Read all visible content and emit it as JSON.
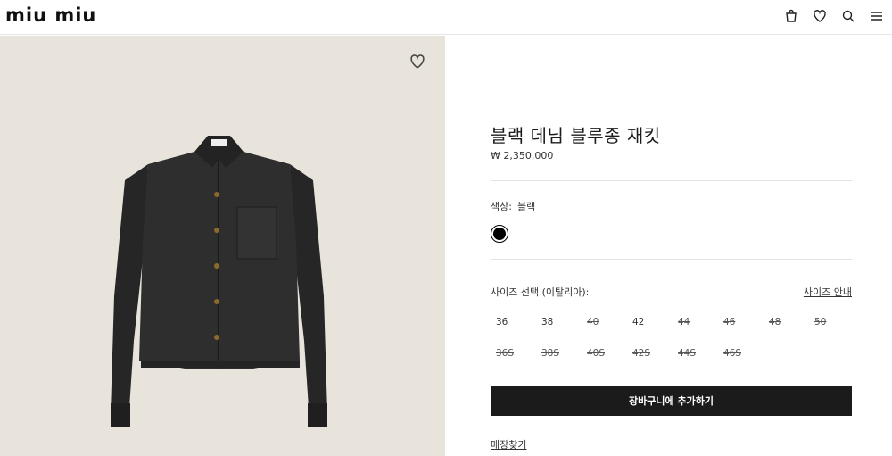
{
  "header": {
    "logo": "miu miu",
    "icons": [
      "bag-icon",
      "heart-icon",
      "search-icon",
      "menu-icon"
    ]
  },
  "product": {
    "title": "블랙 데님 블루종 재킷",
    "price": "₩ 2,350,000",
    "color_label": "색상:",
    "color_value": "블랙",
    "swatch_color": "#000000",
    "size_label": "사이즈 선택 (이탈리아):",
    "size_guide": "사이즈 안내",
    "sizes": [
      {
        "label": "36",
        "available": true
      },
      {
        "label": "38",
        "available": true
      },
      {
        "label": "40",
        "available": false
      },
      {
        "label": "42",
        "available": true
      },
      {
        "label": "44",
        "available": false
      },
      {
        "label": "46",
        "available": false
      },
      {
        "label": "48",
        "available": false
      },
      {
        "label": "50",
        "available": false
      },
      {
        "label": "36S",
        "available": false
      },
      {
        "label": "38S",
        "available": false
      },
      {
        "label": "40S",
        "available": false
      },
      {
        "label": "42S",
        "available": false
      },
      {
        "label": "44S",
        "available": false
      },
      {
        "label": "46S",
        "available": false
      }
    ],
    "add_to_cart": "장바구니에 추가하기",
    "store_finder": "매장찾기"
  },
  "colors": {
    "image_bg": "#e8e4dc",
    "button_bg": "#1b1b1b",
    "jacket": "#2c2c2c"
  }
}
